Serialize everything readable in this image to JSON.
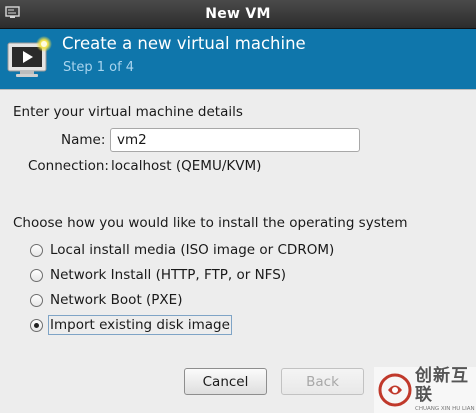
{
  "window": {
    "title": "New VM",
    "icon": "virt-manager-icon"
  },
  "header": {
    "title": "Create a new virtual machine",
    "step": "Step 1 of 4",
    "icon": "monitor-play-icon",
    "bg_color": "#0f76ab"
  },
  "details": {
    "heading": "Enter your virtual machine details",
    "name_label": "Name:",
    "name_value": "vm2",
    "connection_label": "Connection:",
    "connection_value": "localhost (QEMU/KVM)"
  },
  "install": {
    "heading": "Choose how you would like to install the operating system",
    "options": [
      {
        "label": "Local install media (ISO image or CDROM)",
        "selected": false
      },
      {
        "label": "Network Install (HTTP, FTP, or NFS)",
        "selected": false
      },
      {
        "label": "Network Boot (PXE)",
        "selected": false
      },
      {
        "label": "Import existing disk image",
        "selected": true
      }
    ]
  },
  "buttons": {
    "cancel": "Cancel",
    "back": "Back"
  },
  "watermark": {
    "chinese": "创新互联",
    "english": "CHUANG XIN HU LIAN"
  }
}
